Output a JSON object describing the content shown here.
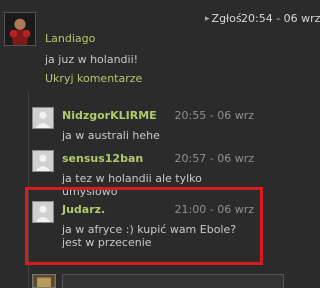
{
  "comment": {
    "report_label": "Zgłoś",
    "timestamp": "20:54 - 06 wrz",
    "username": "Landiago",
    "text": "ja juz w holandii!",
    "hide_label": "Ukryj komentarze"
  },
  "replies": [
    {
      "username": "NidzgorKLIRME",
      "timestamp": "20:55 - 06 wrz",
      "text": "ja w australi hehe"
    },
    {
      "username": "sensus12ban",
      "timestamp": "20:57 - 06 wrz",
      "text": "ja tez w holandii ale tylko umyslowo"
    },
    {
      "username": "Judarz.",
      "timestamp": "21:00 - 06 wrz",
      "text": "ja w afryce :) kupić wam Ebole? jest w przecenie"
    }
  ],
  "colors": {
    "username": "#b4c96a",
    "highlight": "#d91b1b",
    "background": "#2b2b2b"
  }
}
